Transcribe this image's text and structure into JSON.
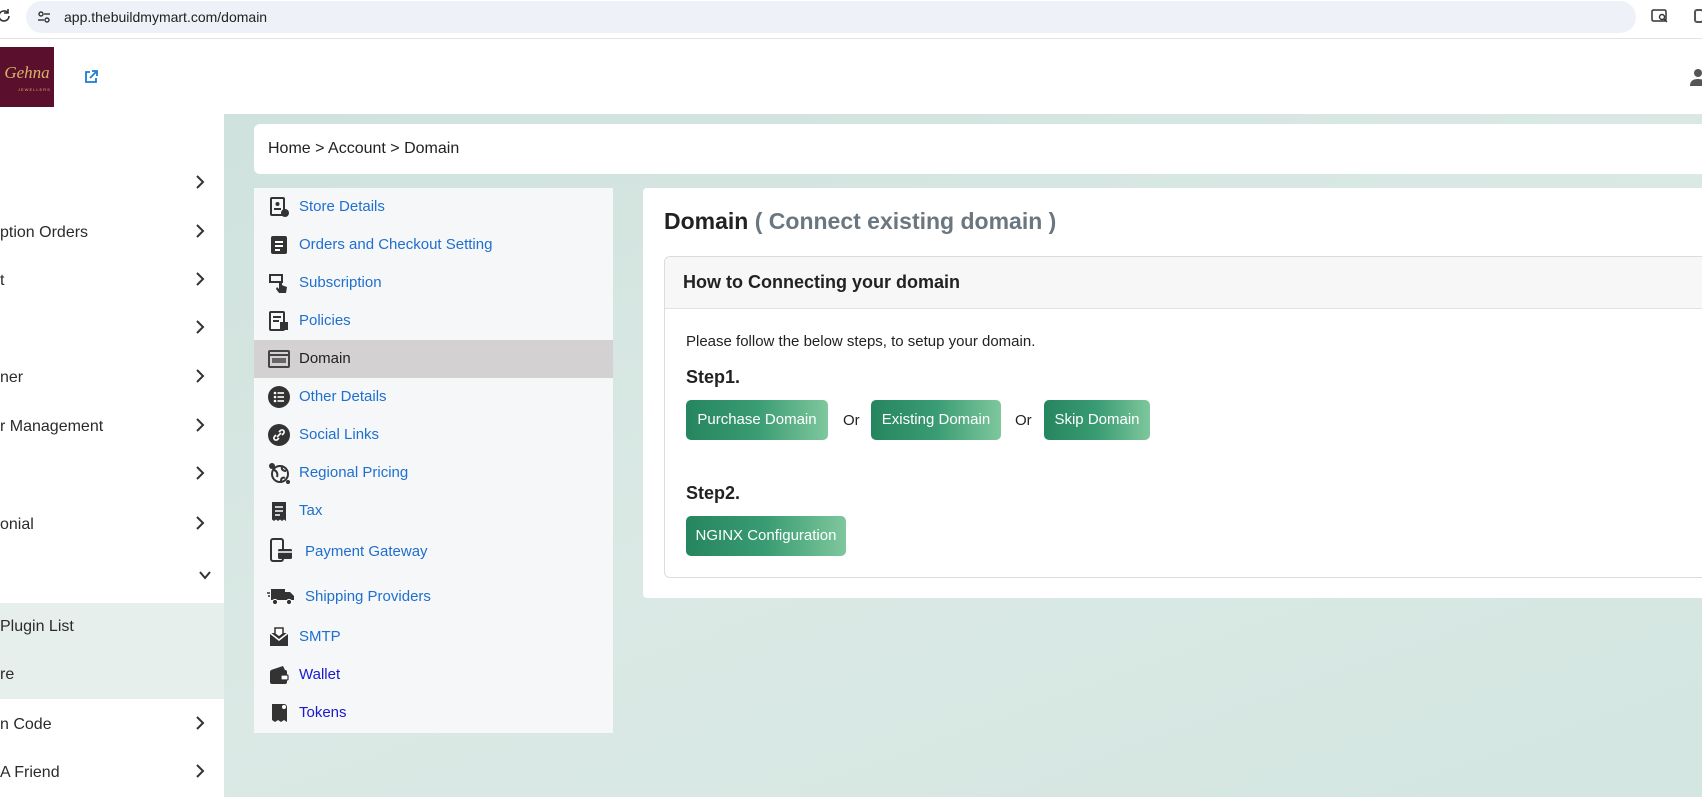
{
  "browser": {
    "url": "app.thebuildmymart.com/domain"
  },
  "header": {
    "logo_text": "Gehna",
    "logo_subtext": "JEWELLERS"
  },
  "left_nav": {
    "items": [
      {
        "label": ""
      },
      {
        "label": "ption Orders"
      },
      {
        "label": "t"
      },
      {
        "label": ""
      },
      {
        "label": "ner"
      },
      {
        "label": "r Management"
      },
      {
        "label": ""
      },
      {
        "label": "onial"
      },
      {
        "label": ""
      }
    ],
    "sub_items": [
      {
        "label": "Plugin List"
      },
      {
        "label": "re"
      }
    ],
    "bottom_items": [
      {
        "label": "n Code"
      },
      {
        "label": "A Friend"
      }
    ]
  },
  "breadcrumb": "Home > Account > Domain",
  "settings_menu": {
    "items": [
      {
        "label": "Store Details",
        "icon": "store-details-icon"
      },
      {
        "label": "Orders and Checkout Setting",
        "icon": "orders-icon"
      },
      {
        "label": "Subscription",
        "icon": "subscription-icon"
      },
      {
        "label": "Policies",
        "icon": "policies-icon"
      },
      {
        "label": "Domain",
        "icon": "domain-icon",
        "active": true
      },
      {
        "label": "Other Details",
        "icon": "list-icon"
      },
      {
        "label": "Social Links",
        "icon": "link-icon"
      },
      {
        "label": "Regional Pricing",
        "icon": "globe-icon"
      },
      {
        "label": "Tax",
        "icon": "receipt-icon"
      },
      {
        "label": "Payment Gateway",
        "icon": "payment-icon"
      },
      {
        "label": "Shipping Providers",
        "icon": "truck-icon"
      },
      {
        "label": "SMTP",
        "icon": "mail-icon"
      },
      {
        "label": "Wallet",
        "icon": "wallet-icon"
      },
      {
        "label": "Tokens",
        "icon": "token-icon"
      }
    ]
  },
  "content": {
    "title": "Domain",
    "title_sub": "( Connect existing domain )",
    "card_title": "How to Connecting your domain",
    "instructions": "Please follow the below steps, to setup your domain.",
    "step1_label": "Step1.",
    "step2_label": "Step2.",
    "purchase_button": "Purchase Domain",
    "existing_button": "Existing Domain",
    "skip_button": "Skip Domain",
    "or1": "Or",
    "or2": "Or",
    "nginx_button": "NGINX Configuration"
  },
  "colors": {
    "accent_green": "#25855f",
    "link_blue": "#1f6fcf",
    "logo_maroon": "#5a0f2c"
  }
}
